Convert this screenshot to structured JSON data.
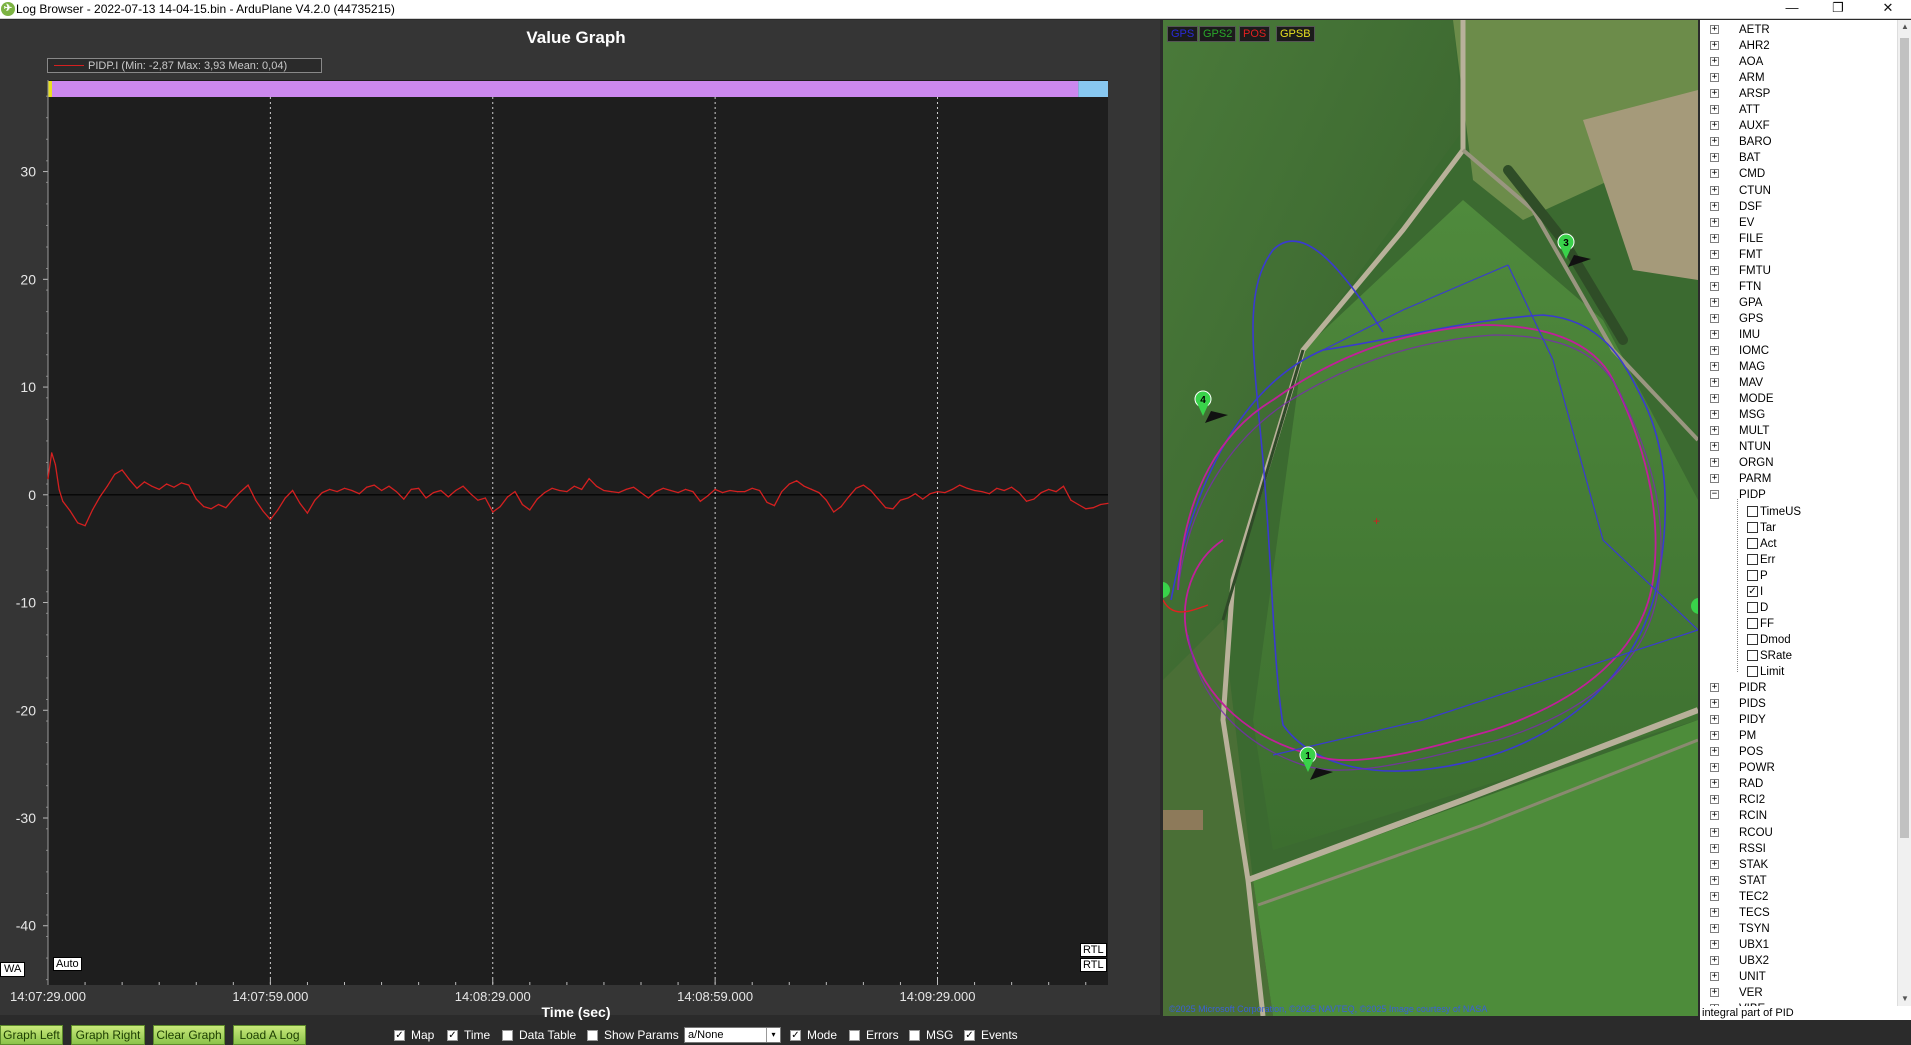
{
  "window": {
    "title": "Log Browser - 2022-07-13 14-04-15.bin - ArduPlane V4.2.0 (44735215)",
    "icon": "arduplane-icon",
    "controls": [
      "minimize",
      "maximize",
      "close"
    ],
    "minimize_glyph": "—",
    "maximize_glyph": "❐",
    "close_glyph": "✕"
  },
  "graph": {
    "title": "Value Graph",
    "legend": "PIDP.I  (Min: -2,87 Max: 3,93 Mean: 0,04)",
    "x_axis_title": "Time (sec)",
    "mode_start_label": "Auto",
    "mode_end_label": "RTL",
    "mode_end_label_bottom": "RTL",
    "wa_label": "WA",
    "colors": {
      "line": "#d42020",
      "auto_band": "#cc88ee",
      "rtl_band": "#88c8f0",
      "background": "#1e1e1e"
    }
  },
  "chart_data": {
    "type": "line",
    "title": "Value Graph",
    "xlabel": "Time (sec)",
    "ylabel": "",
    "x_ticks": [
      "14:07:29.000",
      "14:07:59.000",
      "14:08:29.000",
      "14:08:59.000",
      "14:09:29.000"
    ],
    "y_ticks": [
      30,
      20,
      10,
      0,
      -10,
      -20,
      -30,
      -40
    ],
    "ylim": [
      -45.5,
      38.5
    ],
    "xlim_seconds": [
      0,
      143
    ],
    "grid": "vertical-dotted",
    "series": [
      {
        "name": "PIDP.I",
        "color": "#d42020",
        "x": [
          0,
          0.5,
          1,
          1.5,
          2,
          3,
          4,
          5,
          6,
          7,
          8,
          9,
          10,
          11,
          12,
          13,
          14,
          15,
          16,
          17,
          18,
          19,
          20,
          21,
          22,
          23,
          24,
          25,
          26,
          27,
          28,
          29,
          30,
          31,
          32,
          33,
          34,
          35,
          36,
          37,
          38,
          39,
          40,
          41,
          42,
          43,
          44,
          45,
          46,
          47,
          48,
          49,
          50,
          51,
          52,
          53,
          54,
          55,
          56,
          57,
          58,
          59,
          60,
          61,
          62,
          63,
          64,
          65,
          66,
          67,
          68,
          69,
          70,
          71,
          72,
          73,
          74,
          75,
          76,
          77,
          78,
          79,
          80,
          81,
          82,
          83,
          84,
          85,
          86,
          87,
          88,
          89,
          90,
          91,
          92,
          93,
          94,
          95,
          96,
          97,
          98,
          99,
          100,
          101,
          102,
          103,
          104,
          105,
          106,
          107,
          108,
          109,
          110,
          111,
          112,
          113,
          114,
          115,
          116,
          117,
          118,
          119,
          120,
          121,
          122,
          123,
          124,
          125,
          126,
          127,
          128,
          129,
          130,
          131,
          132,
          133,
          134,
          135,
          136,
          137,
          138,
          139,
          140,
          141,
          142,
          143
        ],
        "values": [
          1.5,
          3.9,
          2.8,
          0.5,
          -0.6,
          -1.5,
          -2.6,
          -2.87,
          -1.4,
          -0.2,
          0.8,
          1.9,
          2.3,
          1.4,
          0.6,
          1.2,
          0.8,
          0.5,
          1.0,
          0.7,
          1.1,
          0.9,
          -0.4,
          -1.1,
          -1.3,
          -0.9,
          -1.2,
          -0.4,
          0.3,
          0.9,
          -0.5,
          -1.5,
          -2.3,
          -1.4,
          -0.3,
          0.4,
          -0.8,
          -1.7,
          -0.5,
          0.2,
          0.5,
          0.3,
          0.6,
          0.4,
          0.1,
          0.7,
          0.9,
          0.4,
          0.8,
          0.3,
          -0.4,
          0.5,
          0.6,
          -0.3,
          0.2,
          0.4,
          -0.2,
          0.4,
          0.8,
          0.1,
          -0.5,
          -0.3,
          -1.6,
          -1.1,
          -0.2,
          0.3,
          -0.9,
          -1.4,
          -0.4,
          0.2,
          0.6,
          0.4,
          0.3,
          0.8,
          0.5,
          1.5,
          0.8,
          0.4,
          0.3,
          0.2,
          0.5,
          0.7,
          0.2,
          -0.3,
          0.3,
          0.6,
          0.4,
          0.2,
          0.5,
          0.3,
          -0.6,
          -0.1,
          0.5,
          0.2,
          0.4,
          0.3,
          0.3,
          0.6,
          0.4,
          -0.7,
          -1.0,
          0.3,
          1.0,
          1.3,
          0.8,
          0.5,
          0.2,
          -0.5,
          -1.6,
          -1.1,
          -0.2,
          0.6,
          0.9,
          0.4,
          -0.4,
          -1.2,
          -1.3,
          -0.5,
          -0.3,
          0.1,
          -0.4,
          0.1,
          0.3,
          0.2,
          0.5,
          0.9,
          0.6,
          0.4,
          0.3,
          0.1,
          0.6,
          0.4,
          0.7,
          0.2,
          -0.6,
          -0.4,
          0.2,
          0.5,
          0.3,
          0.8,
          -0.5,
          -0.9,
          -1.3,
          -1.2,
          -0.9,
          -0.8
        ]
      }
    ],
    "modes": [
      {
        "name": "Auto",
        "from": 0,
        "to": 139
      },
      {
        "name": "RTL",
        "from": 139,
        "to": 143
      }
    ]
  },
  "map": {
    "layers": [
      {
        "name": "GPS",
        "color": "#2a2ad8"
      },
      {
        "name": "GPS2",
        "color": "#2aa82a"
      },
      {
        "name": "POS",
        "color": "#e02020"
      },
      {
        "name": "GPSB",
        "color": "#e8e020"
      }
    ],
    "waypoints": [
      "1",
      "3",
      "4"
    ],
    "credit": "©2025 Microsoft Corporation, ©2025 NAVTEQ, ©2025 Image courtesy of NASA"
  },
  "tree": {
    "expand_glyph": "+",
    "collapse_glyph": "−",
    "check_glyph": "✓",
    "items_top": [
      "AETR",
      "AHR2",
      "AOA",
      "ARM",
      "ARSP",
      "ATT",
      "AUXF",
      "BARO",
      "BAT",
      "CMD",
      "CTUN",
      "DSF",
      "EV",
      "FILE",
      "FMT",
      "FMTU",
      "FTN",
      "GPA",
      "GPS",
      "IMU",
      "IOMC",
      "MAG",
      "MAV",
      "MODE",
      "MSG",
      "MULT",
      "NTUN",
      "ORGN",
      "PARM"
    ],
    "expanded_item": "PIDP",
    "children": [
      {
        "label": "TimeUS",
        "checked": false
      },
      {
        "label": "Tar",
        "checked": false
      },
      {
        "label": "Act",
        "checked": false
      },
      {
        "label": "Err",
        "checked": false
      },
      {
        "label": "P",
        "checked": false
      },
      {
        "label": "I",
        "checked": true
      },
      {
        "label": "D",
        "checked": false
      },
      {
        "label": "FF",
        "checked": false
      },
      {
        "label": "Dmod",
        "checked": false
      },
      {
        "label": "SRate",
        "checked": false
      },
      {
        "label": "Limit",
        "checked": false
      }
    ],
    "items_bottom": [
      "PIDR",
      "PIDS",
      "PIDY",
      "PM",
      "POS",
      "POWR",
      "RAD",
      "RCI2",
      "RCIN",
      "RCOU",
      "RSSI",
      "STAK",
      "STAT",
      "TEC2",
      "TECS",
      "TSYN",
      "UBX1",
      "UBX2",
      "UNIT",
      "VER",
      "VIBE"
    ],
    "status": "integral part of PID"
  },
  "toolbar": {
    "buttons": [
      "Graph Left",
      "Graph Right",
      "Clear Graph",
      "Load A Log"
    ],
    "checks": [
      {
        "label": "Map",
        "checked": true
      },
      {
        "label": "Time",
        "checked": true
      },
      {
        "label": "Data Table",
        "checked": false
      },
      {
        "label": "Show Params",
        "checked": false
      }
    ],
    "combo_value": "a/None",
    "checks_right": [
      {
        "label": "Mode",
        "checked": true
      },
      {
        "label": "Errors",
        "checked": false
      },
      {
        "label": "MSG",
        "checked": false
      },
      {
        "label": "Events",
        "checked": true
      }
    ],
    "check_glyph": "✓",
    "combo_arrow": "▾"
  }
}
